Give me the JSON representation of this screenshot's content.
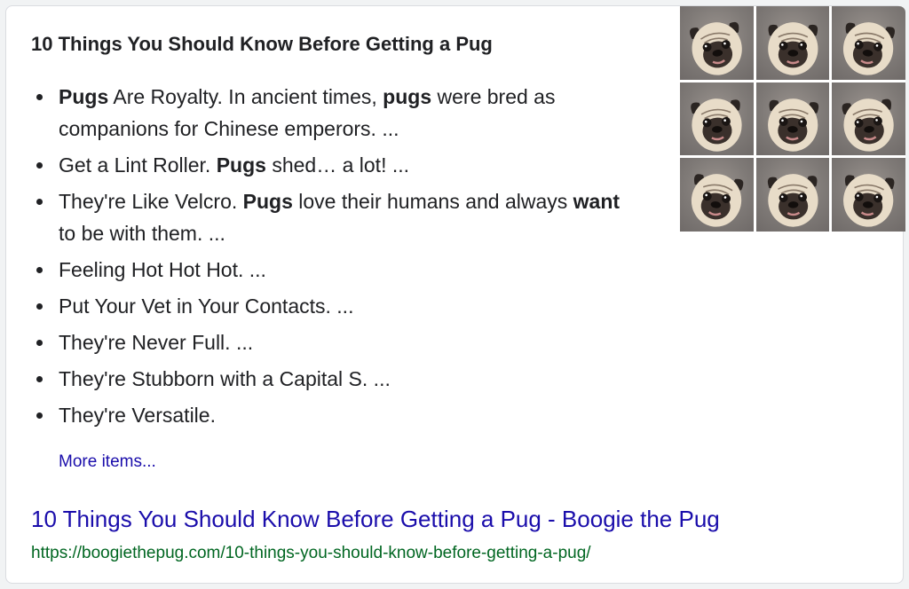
{
  "snippet": {
    "heading": "10 Things You Should Know Before Getting a Pug",
    "items": [
      {
        "lines": [
          [
            "Pugs",
            true
          ],
          [
            " Are Royalty. In ancient times, ",
            false
          ],
          [
            "pugs",
            true
          ],
          [
            " were bred as companions for Chinese emperors. ...",
            false
          ]
        ]
      },
      {
        "lines": [
          [
            "Get a Lint Roller. ",
            false
          ],
          [
            "Pugs",
            true
          ],
          [
            " shed… a lot! ...",
            false
          ]
        ]
      },
      {
        "lines": [
          [
            "They're Like Velcro. ",
            false
          ],
          [
            "Pugs",
            true
          ],
          [
            " love their humans and always ",
            false
          ],
          [
            "want",
            true
          ],
          [
            " to be with them. ...",
            false
          ]
        ]
      },
      {
        "lines": [
          [
            "Feeling Hot Hot Hot. ...",
            false
          ]
        ]
      },
      {
        "lines": [
          [
            "Put Your Vet in Your Contacts. ...",
            false
          ]
        ]
      },
      {
        "lines": [
          [
            "They're Never Full. ...",
            false
          ]
        ]
      },
      {
        "lines": [
          [
            "They're Stubborn with a Capital S. ...",
            false
          ]
        ]
      },
      {
        "lines": [
          [
            "They're Versatile.",
            false
          ]
        ]
      }
    ],
    "more_label": "More items..."
  },
  "result": {
    "title": "10 Things You Should Know Before Getting a Pug - Boogie the Pug",
    "url": "https://boogiethepug.com/10-things-you-should-know-before-getting-a-pug/"
  },
  "image_grid": {
    "icon": "pug-photo-grid",
    "tiles": 9
  },
  "colors": {
    "link": "#1a0dab",
    "url": "#006621",
    "text": "#202124"
  }
}
